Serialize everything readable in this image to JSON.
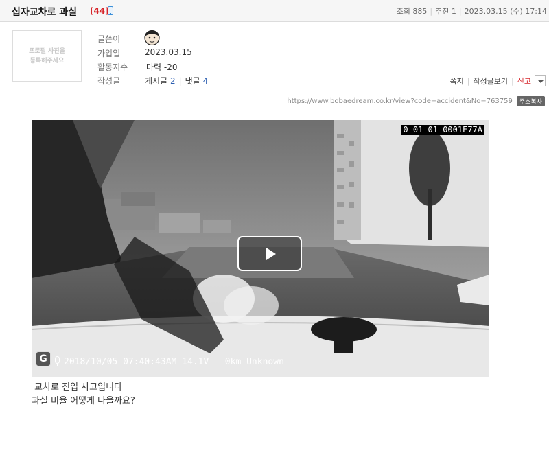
{
  "header": {
    "title": "십자교차로 과실",
    "comment_count": "[44]",
    "views": "조회 885",
    "recommends": "추천 1",
    "date": "2023.03.15 (수) 17:14"
  },
  "profile": {
    "photo_placeholder_line1": "프로필 사진을",
    "photo_placeholder_line2": "등록해주세요",
    "author_label": "글쓴이",
    "joined_label": "가입일",
    "joined_value": "2023.03.15",
    "activity_label": "활동지수",
    "activity_value": "마력 -20",
    "posts_label": "작성글",
    "posts_text": "게시글",
    "posts_count": "2",
    "comments_text": "댓글",
    "comments_count": "4"
  },
  "actions": {
    "message": "쪽지",
    "view_posts": "작성글보기",
    "report": "신고"
  },
  "url": {
    "text": "https://www.bobaedream.co.kr/view?code=accident&No=763759",
    "copy_label": "주소복사"
  },
  "video": {
    "camera_id": "0-01-01-0001E77A",
    "osd": "2018/10/05 07:40:43AM 14.1V   0km Unknown",
    "logo_letter": "G"
  },
  "body": {
    "line1": " 교차로 진입 사고입니다",
    "line2": "과실 비율 어떻게 나올까요?"
  },
  "icons": [
    "mobile-icon",
    "avatar-icon",
    "dropdown-icon",
    "play-icon",
    "mic-icon",
    "g-logo-icon"
  ],
  "colors": {
    "accent_red": "#d7262b",
    "link_blue": "#2a5db0"
  }
}
